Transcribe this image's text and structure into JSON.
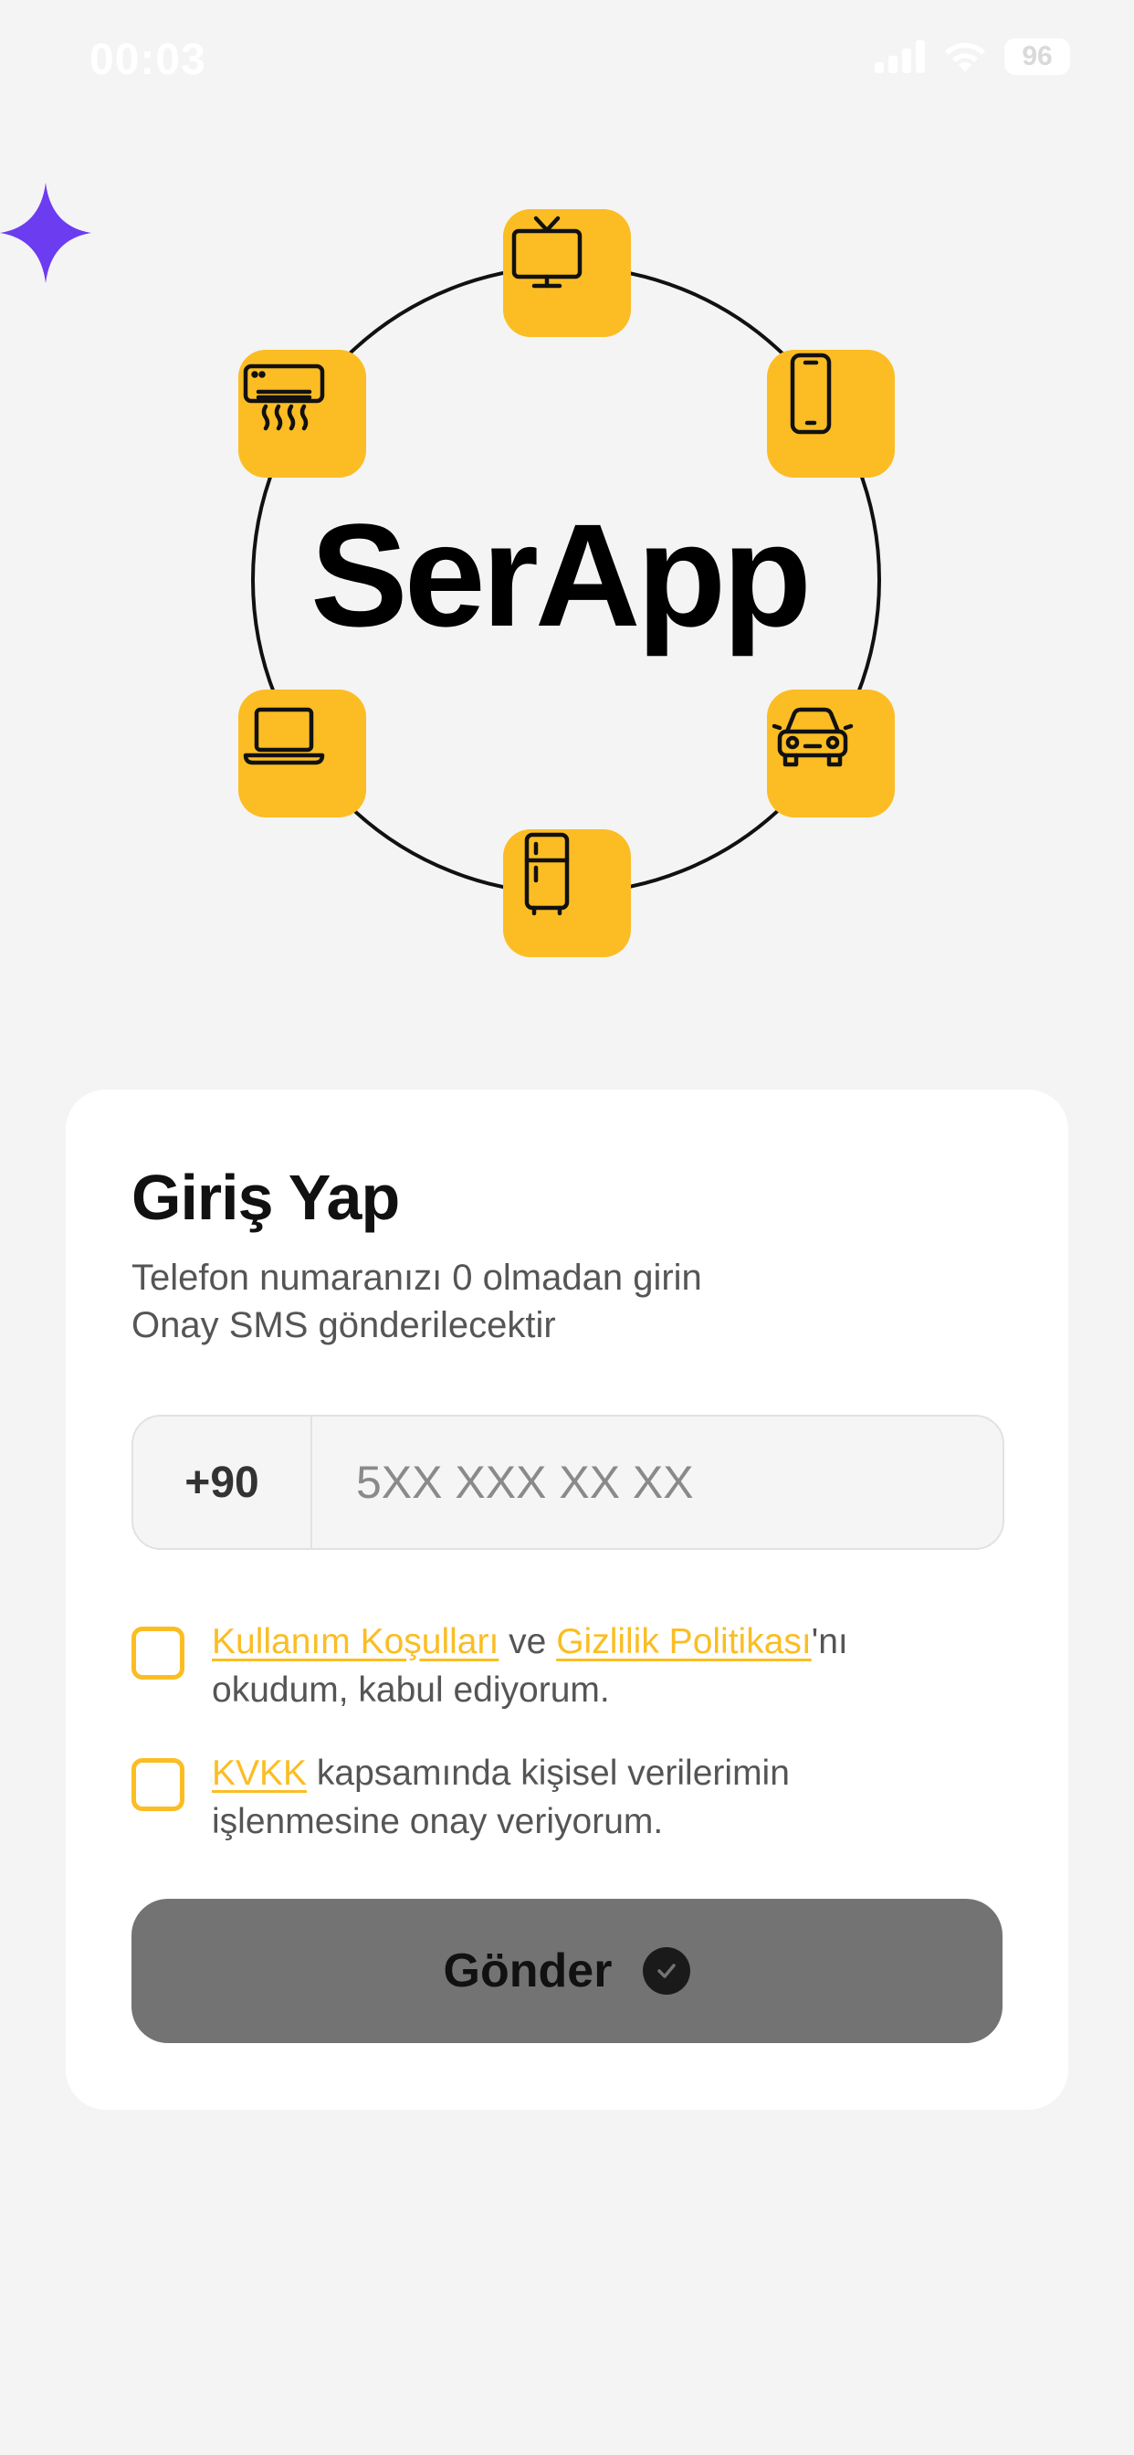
{
  "status_bar": {
    "time": "00:03",
    "battery": "96",
    "icons": [
      "cellular-signal-icon",
      "wifi-icon",
      "battery-icon"
    ]
  },
  "hero": {
    "logo_text": "SerApp",
    "sparkle_color": "#6c3cf0",
    "tile_color": "#fbbd23",
    "icons": [
      "tv-icon",
      "phone-icon",
      "car-icon",
      "fridge-icon",
      "laptop-icon",
      "air-conditioner-icon"
    ]
  },
  "login": {
    "title": "Giriş Yap",
    "subtitle_line1": "Telefon numaranızı 0 olmadan girin",
    "subtitle_line2": "Onay SMS gönderilecektir",
    "country_code": "+90",
    "phone_placeholder": "5XX XXX XX XX",
    "terms": {
      "link1": "Kullanım Koşulları",
      "connector": " ve ",
      "link2": "Gizlilik Politikası",
      "suffix": "'nı",
      "line2": "okudum, kabul ediyorum."
    },
    "kvkk": {
      "link": "KVKK",
      "suffix": " kapsamında kişisel verilerimin",
      "line2": "işlenmesine onay veriyorum."
    },
    "submit_label": "Gönder",
    "accent_color": "#fbbd23",
    "submit_color": "#737373"
  }
}
